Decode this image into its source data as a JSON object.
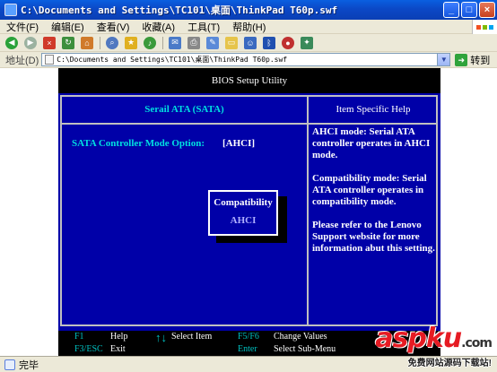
{
  "window": {
    "title": "C:\\Documents and Settings\\TC101\\桌面\\ThinkPad T60p.swf",
    "buttons": {
      "minimize": "_",
      "maximize": "□",
      "close": "×"
    }
  },
  "menu": [
    "文件(F)",
    "编辑(E)",
    "查看(V)",
    "收藏(A)",
    "工具(T)",
    "帮助(H)"
  ],
  "address": {
    "label": "地址(D)",
    "value": "C:\\Documents and Settings\\TC101\\桌面\\ThinkPad T60p.swf",
    "go_label": "转到"
  },
  "bios": {
    "header": "BIOS Setup Utility",
    "section_title": "Serail ATA (SATA)",
    "help_title": "Item Specific Help",
    "option_label": "SATA Controller Mode Option:",
    "option_value": "[AHCI]",
    "popup": {
      "selected": "Compatibility",
      "other": "AHCI"
    },
    "help": [
      "AHCI mode: Serial ATA controller operates in AHCI mode.",
      "Compatibility mode: Serial ATA controller operates in compatibility mode.",
      "Please refer to the Lenovo Support website for more information abut this setting."
    ],
    "footer": {
      "f1": "F1",
      "help": "Help",
      "arrows": "↑↓",
      "select_item": "Select Item",
      "f5f6": "F5/F6",
      "change_values": "Change Values",
      "f3esc": "F3/ESC",
      "exit": "Exit",
      "enter": "Enter",
      "select_submenu": "Select Sub-Menu"
    }
  },
  "status": {
    "text": "完毕"
  },
  "watermark": {
    "logo": "aspku",
    "tld": ".com",
    "sub": "免费网站源码下载站!"
  }
}
